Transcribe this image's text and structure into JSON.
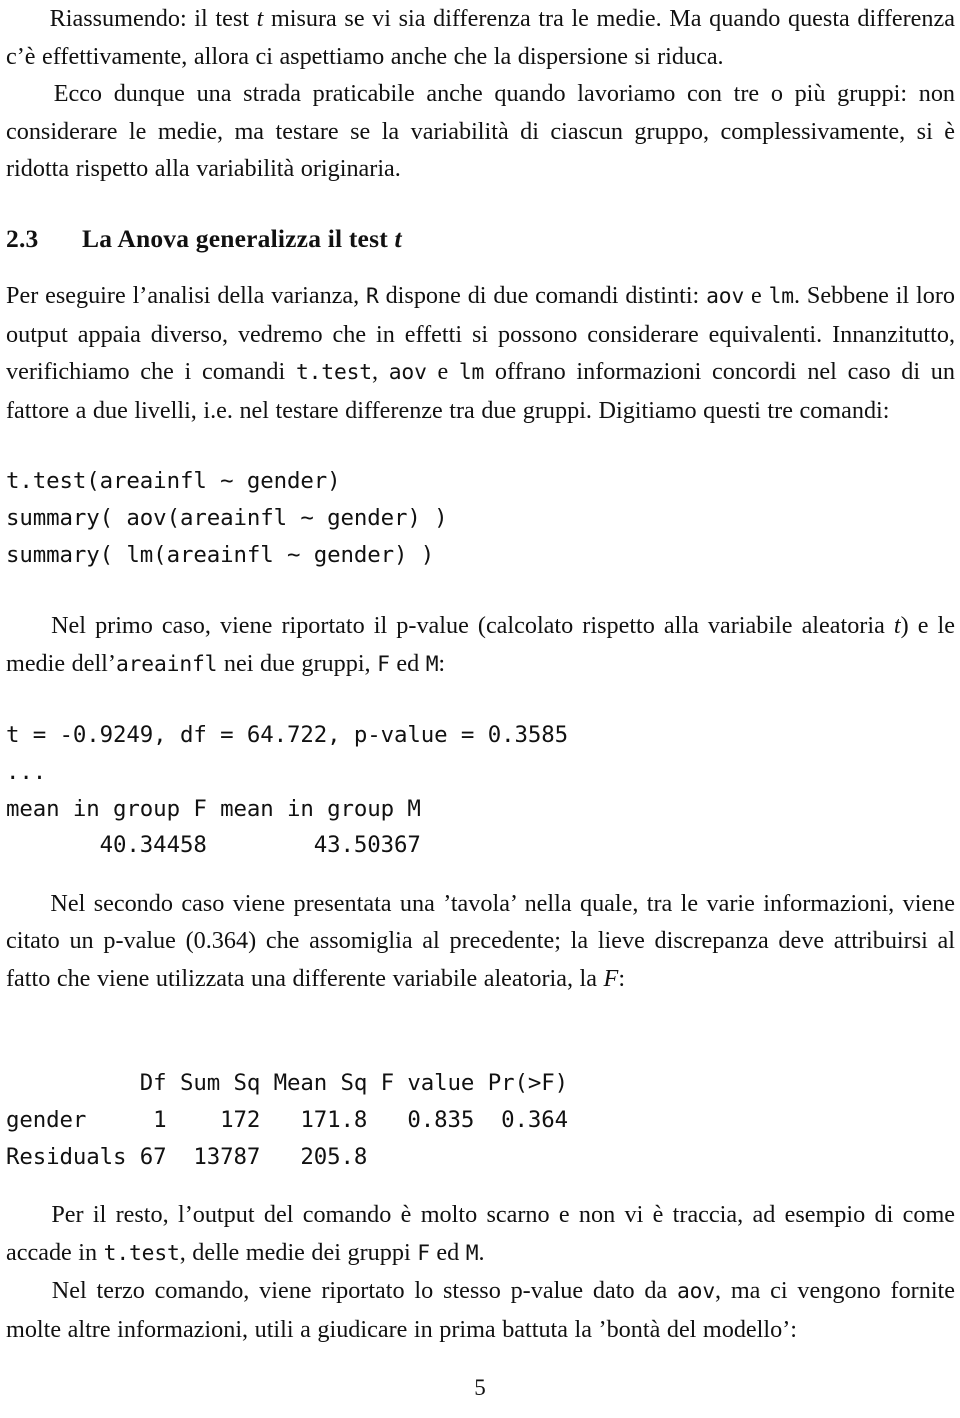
{
  "document": {
    "page_number": "5",
    "language": "it"
  },
  "paragraphs": {
    "p1": {
      "seg1": "Riassumendo: il test ",
      "math1": "t",
      "seg2": " misura se vi sia differenza tra le medie. Ma quando questa differenza c’è effettivamente, allora ci aspettiamo anche che la dispersione si riduca."
    },
    "p2": {
      "text": "Ecco dunque una strada praticabile anche quando lavoriamo con tre o più gruppi: non considerare le medie, ma testare se la variabilità di ciascun gruppo, complessivamente, si è ridotta rispetto alla variabilità originaria."
    },
    "p3": {
      "seg1": "Per eseguire l’analisi della varianza, ",
      "code1": "R",
      "seg2": " dispone di due comandi distinti: ",
      "code2": "aov",
      "seg3": " e ",
      "code3": "lm",
      "seg4": ". Sebbene il loro output appaia diverso, vedremo che in effetti si possono considerare equivalenti. Innanzitutto, verifichiamo che i comandi ",
      "code4": "t.test",
      "seg5": ", ",
      "code5": "aov",
      "seg6": " e ",
      "code6": "lm",
      "seg7": " offrano informazioni concordi nel caso di un fattore a due livelli, i.e. nel testare differenze tra due gruppi. Digitiamo questi tre comandi:"
    },
    "p4": {
      "seg1": "Nel primo caso, viene riportato il p-value (calcolato rispetto alla variabile aleatoria ",
      "math1": "t",
      "seg2": ") e le medie dell’",
      "code1": "areainfl",
      "seg3": " nei due gruppi, ",
      "code2": "F",
      "seg4": " ed ",
      "code3": "M",
      "seg5": ":"
    },
    "p5": {
      "seg1": "Nel secondo caso viene presentata una ’tavola’ nella quale, tra le varie informazioni, viene citato un p-value (0.364) che assomiglia al precedente; la lieve discrepanza deve attribuirsi al fatto che viene utilizzata una differente variabile aleatoria, la ",
      "math1": "F",
      "seg2": ":"
    },
    "p6": {
      "seg1": "Per il resto, l’output del comando è molto scarno e non vi è traccia, ad esempio di come accade in ",
      "code1": "t.test",
      "seg2": ", delle medie dei gruppi ",
      "code2": "F",
      "seg3": " ed ",
      "code3": "M",
      "seg4": "."
    },
    "p7": {
      "seg1": "Nel terzo comando, viene riportato lo stesso p-value dato da ",
      "code1": "aov",
      "seg2": ", ma ci vengono fornite molte altre informazioni, utili a giudicare in prima battuta la ’bontà del modello’:"
    }
  },
  "section": {
    "number": "2.3",
    "title_before_math": "La Anova generalizza il test ",
    "title_math": "t"
  },
  "code_blocks": {
    "commands": "t.test(areainfl ~ gender)\nsummary( aov(areainfl ~ gender) )\nsummary( lm(areainfl ~ gender) )",
    "ttest_output": "t = -0.9249, df = 64.722, p-value = 0.3585\n...\nmean in group F mean in group M\n       40.34458        43.50367",
    "anova_table": "          Df Sum Sq Mean Sq F value Pr(>F)\ngender     1    172   171.8   0.835  0.364\nResiduals 67  13787   205.8"
  },
  "r_results": {
    "t_test": {
      "t": "-0.9249",
      "df": "64.722",
      "p_value": "0.3585",
      "mean_group_F": "40.34458",
      "mean_group_M": "43.50367",
      "labels": {
        "t": "t",
        "df": "df",
        "p_value": "p-value",
        "mean_F": "mean in group F",
        "mean_M": "mean in group M",
        "ellipsis": "..."
      }
    },
    "anova": {
      "columns": [
        "",
        "Df",
        "Sum Sq",
        "Mean Sq",
        "F value",
        "Pr(>F)"
      ],
      "rows": [
        [
          "gender",
          "1",
          "172",
          "171.8",
          "0.835",
          "0.364"
        ],
        [
          "Residuals",
          "67",
          "13787",
          "205.8",
          "",
          ""
        ]
      ]
    }
  }
}
